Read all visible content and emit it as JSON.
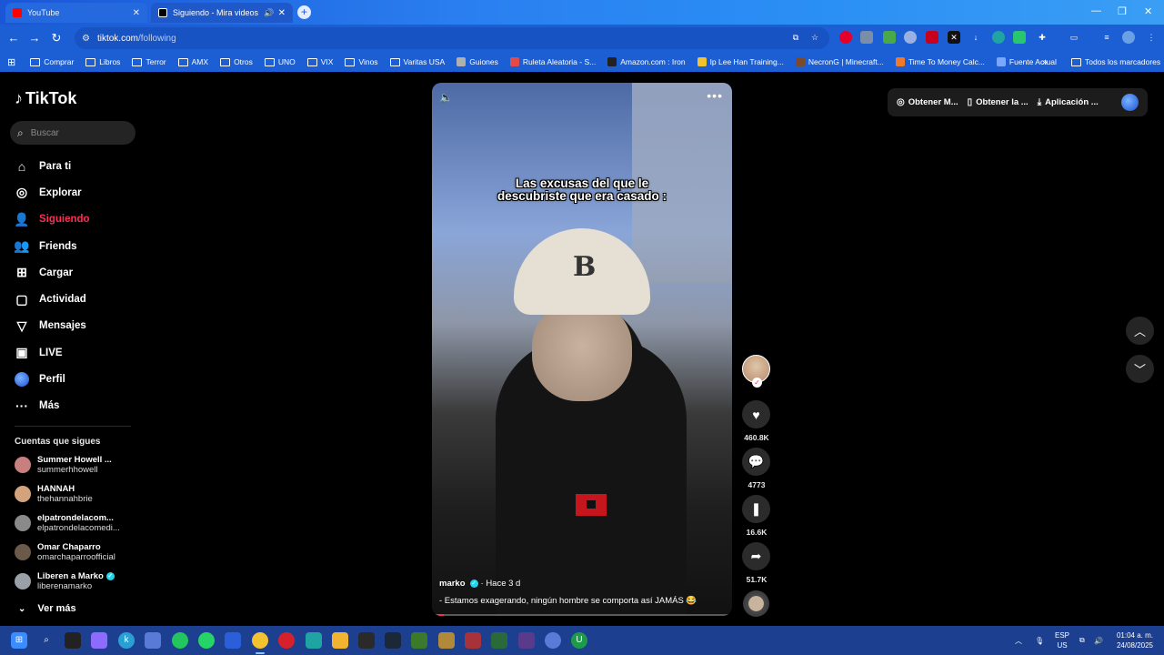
{
  "browser": {
    "tabs": [
      {
        "title": "YouTube",
        "favicon_color": "#ff0000"
      },
      {
        "title": "Siguiendo - Mira videos pu",
        "favicon_color": "#000000"
      }
    ],
    "address": {
      "host": "tiktok.com",
      "path": "/following"
    },
    "bookmarks": [
      {
        "label": "Comprar",
        "type": "folder"
      },
      {
        "label": "Libros",
        "type": "folder"
      },
      {
        "label": "Terror",
        "type": "folder"
      },
      {
        "label": "AMX",
        "type": "folder"
      },
      {
        "label": "Otros",
        "type": "folder"
      },
      {
        "label": "UNO",
        "type": "folder"
      },
      {
        "label": "VIX",
        "type": "folder"
      },
      {
        "label": "Vinos",
        "type": "folder"
      },
      {
        "label": "Varitas USA",
        "type": "folder"
      },
      {
        "label": "Guiones",
        "type": "site",
        "color": "#b0b0b0"
      },
      {
        "label": "Ruleta Aleatoria - S...",
        "type": "site",
        "color": "#e34b4b"
      },
      {
        "label": "Amazon.com : Iron",
        "type": "site",
        "color": "#222222"
      },
      {
        "label": "Ip Lee Han Training...",
        "type": "site",
        "color": "#f2c230"
      },
      {
        "label": "NecronG | Minecraft...",
        "type": "site",
        "color": "#7a4a2a"
      },
      {
        "label": "Time To Money Calc...",
        "type": "site",
        "color": "#f07a2a"
      },
      {
        "label": "Fuente Actual",
        "type": "site",
        "color": "#7aa7ff"
      }
    ],
    "all_bookmarks_label": "Todos los marcadores"
  },
  "tiktok": {
    "logo_text": "TikTok",
    "search_placeholder": "Buscar",
    "nav": [
      {
        "label": "Para ti",
        "icon": "home-icon",
        "active": false
      },
      {
        "label": "Explorar",
        "icon": "compass-icon",
        "active": false
      },
      {
        "label": "Siguiendo",
        "icon": "following-icon",
        "active": true
      },
      {
        "label": "Friends",
        "icon": "friends-icon",
        "active": false
      },
      {
        "label": "Cargar",
        "icon": "upload-icon",
        "active": false
      },
      {
        "label": "Actividad",
        "icon": "activity-icon",
        "active": false
      },
      {
        "label": "Mensajes",
        "icon": "messages-icon",
        "active": false
      },
      {
        "label": "LIVE",
        "icon": "live-icon",
        "active": false
      },
      {
        "label": "Perfil",
        "icon": "profile-avatar-icon",
        "active": false
      },
      {
        "label": "Más",
        "icon": "more-icon",
        "active": false
      }
    ],
    "following_title": "Cuentas que sigues",
    "following": [
      {
        "name": "Summer Howell ...",
        "handle": "summerhhowell",
        "verified": false,
        "color": "#c77f7f"
      },
      {
        "name": "HANNAH",
        "handle": "thehannahbrie",
        "verified": false,
        "color": "#d3a37e"
      },
      {
        "name": "elpatrondelacom...",
        "handle": "elpatrondelacomedi...",
        "verified": false,
        "color": "#8a8a8a"
      },
      {
        "name": "Omar Chaparro",
        "handle": "omarchaparroofficial",
        "verified": false,
        "color": "#6b5a4a"
      },
      {
        "name": "Liberen a Marko",
        "handle": "liberenamarko",
        "verified": true,
        "color": "#9aa0a8"
      }
    ],
    "see_more": "Ver más",
    "video": {
      "overlay_text": "Las excusas del que le descubriste que era casado :",
      "author": "marko",
      "time": "· Hace 3 d",
      "caption": "- Estamos exagerando, ningún hombre se comporta así JAMÁS 😂",
      "progress_fraction": 0.04
    },
    "actions": {
      "likes": "460.8K",
      "comments": "4773",
      "saves": "16.6K",
      "shares": "51.7K"
    },
    "topbar": {
      "coins": "Obtener M...",
      "app": "Obtener la ...",
      "desktop": "Aplicación ..."
    }
  },
  "taskbar": {
    "lang_top": "ESP",
    "lang_bottom": "US",
    "time": "01:04 a. m.",
    "date": "24/08/2025"
  }
}
